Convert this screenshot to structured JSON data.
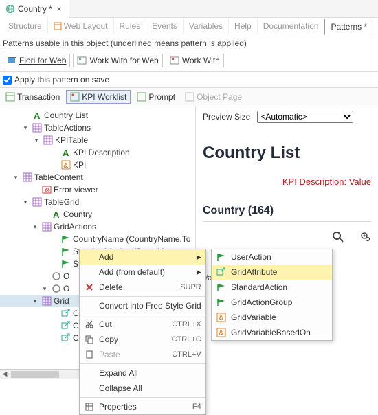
{
  "tab": {
    "title": "Country *",
    "close": "×"
  },
  "subtabs": [
    "Structure",
    "Web Layout",
    "Rules",
    "Events",
    "Variables",
    "Help",
    "Documentation",
    "Patterns *"
  ],
  "hint": "Patterns usable in this object (underlined means pattern is applied)",
  "patterns": [
    "Fiori for Web",
    "Work With for Web",
    "Work With"
  ],
  "apply": "Apply this pattern on save",
  "toolbar": [
    "Transaction",
    "KPI Worklist",
    "Prompt",
    "Object Page"
  ],
  "tree": {
    "items": [
      {
        "ind": 30,
        "exp": "",
        "ic": "A",
        "t": "Country List"
      },
      {
        "ind": 30,
        "exp": "v",
        "ic": "grid",
        "t": "TableActions"
      },
      {
        "ind": 46,
        "exp": "v",
        "ic": "grid",
        "t": "KPITable"
      },
      {
        "ind": 72,
        "exp": "",
        "ic": "A",
        "t": "KPI Description:"
      },
      {
        "ind": 72,
        "exp": "",
        "ic": "amp",
        "t": "KPI"
      },
      {
        "ind": 16,
        "exp": "v",
        "ic": "grid",
        "t": "TableContent"
      },
      {
        "ind": 44,
        "exp": "",
        "ic": "err",
        "t": "Error viewer"
      },
      {
        "ind": 30,
        "exp": "v",
        "ic": "grid",
        "t": "TableGrid"
      },
      {
        "ind": 58,
        "exp": "",
        "ic": "A",
        "t": "Country"
      },
      {
        "ind": 44,
        "exp": "v",
        "ic": "grid",
        "t": "GridActions"
      },
      {
        "ind": 72,
        "exp": "",
        "ic": "flag",
        "t": "CountryName (CountryName.To"
      },
      {
        "ind": 72,
        "exp": "",
        "ic": "flag",
        "t": "Standard Action (Search)"
      },
      {
        "ind": 72,
        "exp": "",
        "ic": "flag",
        "t": "St"
      },
      {
        "ind": 58,
        "exp": "",
        "ic": "circ",
        "t": "O"
      },
      {
        "ind": 58,
        "exp": "v",
        "ic": "circ",
        "t": "O"
      },
      {
        "ind": 44,
        "exp": "v",
        "ic": "grid",
        "t": "Grid",
        "sel": true
      },
      {
        "ind": 72,
        "exp": "",
        "ic": "lnk",
        "t": "Co"
      },
      {
        "ind": 72,
        "exp": "",
        "ic": "lnk",
        "t": "Co"
      },
      {
        "ind": 72,
        "exp": "",
        "ic": "lnk",
        "t": "Co"
      }
    ]
  },
  "ctx1": [
    {
      "ic": "",
      "t": "Add",
      "hl": true,
      "arr": true
    },
    {
      "ic": "",
      "t": "Add (from default)",
      "arr": true
    },
    {
      "ic": "x",
      "t": "Delete",
      "sc": "SUPR"
    },
    {
      "sep": true
    },
    {
      "ic": "",
      "t": "Convert into Free Style Grid"
    },
    {
      "sep": true
    },
    {
      "ic": "cut",
      "t": "Cut",
      "sc": "CTRL+X"
    },
    {
      "ic": "copy",
      "t": "Copy",
      "sc": "CTRL+C"
    },
    {
      "ic": "paste",
      "t": "Paste",
      "sc": "CTRL+V",
      "dim": true
    },
    {
      "sep": true
    },
    {
      "ic": "",
      "t": "Expand All"
    },
    {
      "ic": "",
      "t": "Collapse All"
    },
    {
      "sep": true
    },
    {
      "ic": "prop",
      "t": "Properties",
      "sc": "F4"
    }
  ],
  "ctx2": [
    {
      "ic": "flag",
      "t": "UserAction"
    },
    {
      "ic": "lnk",
      "t": "GridAttribute",
      "hl": true
    },
    {
      "ic": "flag",
      "t": "StandardAction"
    },
    {
      "ic": "flag",
      "t": "GridActionGroup"
    },
    {
      "ic": "amp",
      "t": "GridVariable"
    },
    {
      "ic": "amp",
      "t": "GridVariableBasedOn"
    }
  ],
  "preview": {
    "label": "Preview Size",
    "sel": "<Automatic>",
    "title": "Country List",
    "kpi": "KPI Description: Value",
    "subtitle": "Country (164)",
    "value": "Value"
  }
}
